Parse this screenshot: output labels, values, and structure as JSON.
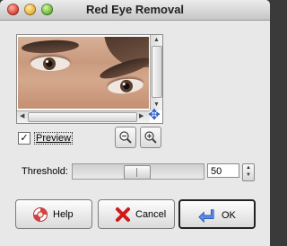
{
  "window": {
    "title": "Red Eye Removal"
  },
  "preview": {
    "checkbox_label": "Preview",
    "checked": true
  },
  "threshold": {
    "label": "Threshold:",
    "value": "50",
    "slider_min": 0,
    "slider_max": 100,
    "slider_value": 50
  },
  "buttons": {
    "help": "Help",
    "cancel": "Cancel",
    "ok": "OK"
  },
  "icons": {
    "zoom_out": "zoom-out-icon",
    "zoom_in": "zoom-in-icon",
    "navigate": "navigate-icon",
    "help": "lifebuoy-icon",
    "cancel": "cancel-x-icon",
    "ok": "ok-arrow-icon"
  },
  "colors": {
    "cancel_red": "#d01818",
    "help_red": "#d84040",
    "ok_blue": "#2a66d8",
    "navigate_blue": "#2a5fc8"
  }
}
